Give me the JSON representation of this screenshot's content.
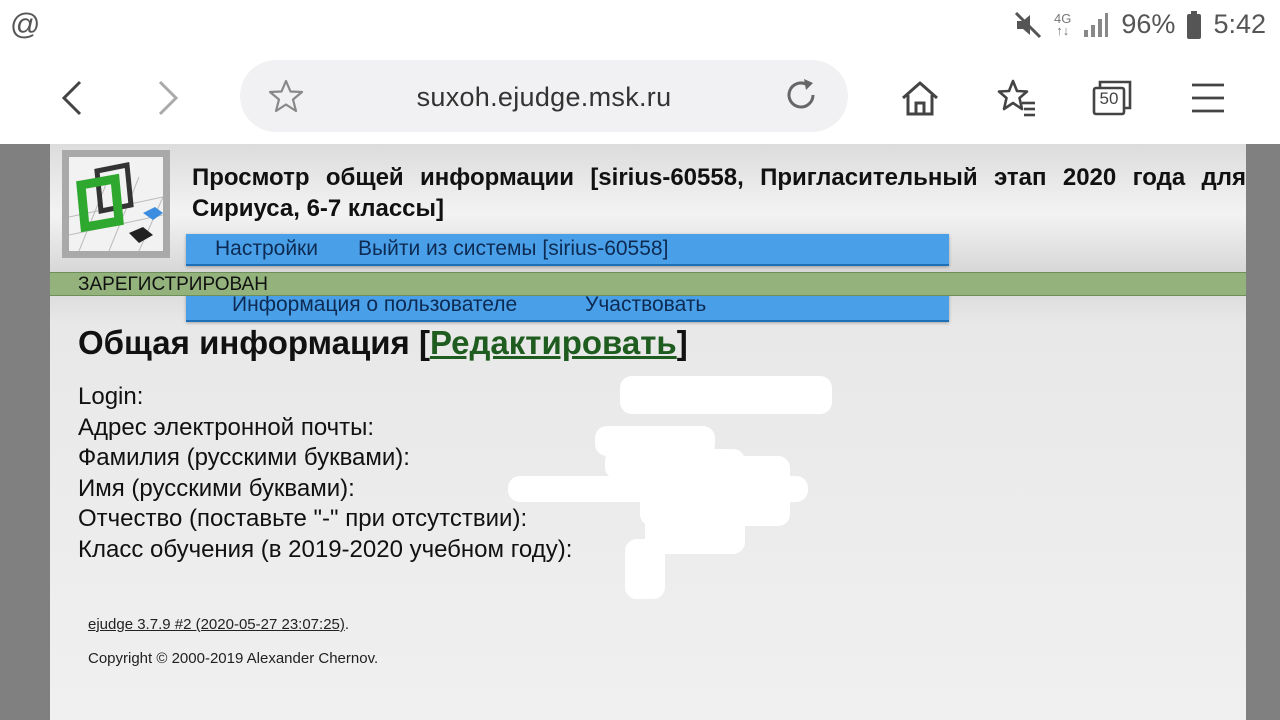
{
  "status_bar": {
    "left_icon": "at-icon",
    "network": "4G",
    "battery": "96%",
    "time": "5:42"
  },
  "browser": {
    "url": "suxoh.ejudge.msk.ru",
    "tabs_count": "50"
  },
  "page": {
    "title": "Просмотр общей информации [sirius-60558, Пригласительный этап 2020 года для Сириуса, 6-7 классы]",
    "menu_top": [
      "Настройки",
      "Выйти из системы [sirius-60558]"
    ],
    "menu_bottom": [
      "Информация о пользователе",
      "Участвовать"
    ],
    "status": "ЗАРЕГИСТРИРОВАН",
    "section_title": "Общая информация [",
    "edit_link": "Редактировать",
    "section_title_end": "]",
    "fields": [
      "Login:",
      "Адрес электронной почты:",
      "Фамилия (русскими буквами):",
      "Имя (русскими буквами):",
      "Отчество (поставьте \"-\" при отсутствии):",
      "Класс обучения (в 2019-2020 учебном году):"
    ],
    "footer_version": "ejudge 3.7.9 #2 (2020-05-27 23:07:25)",
    "footer_version_end": ".",
    "footer_copyright": "Copyright © 2000-2019 Alexander Chernov."
  },
  "colors": {
    "menu_blue": "#4aa0e8",
    "status_green": "#93b27c",
    "link_green": "#1f5c1f"
  }
}
